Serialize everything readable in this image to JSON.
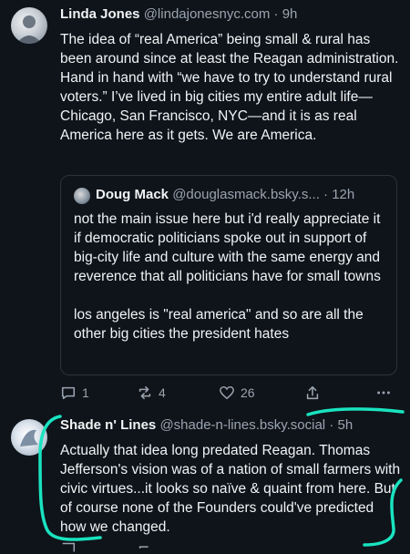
{
  "post1": {
    "name": "Linda Jones",
    "handle": "@lindajonesnyc.com",
    "dot": "·",
    "time": "9h",
    "text": "The idea of “real America” being small & rural has been around since at least the Reagan administration. Hand in hand with “we have to try to understand rural voters.” I’ve lived in big cities my entire adult life—Chicago, San Francisco, NYC—and it is as real America here as it gets. We are America."
  },
  "quote": {
    "name": "Doug Mack",
    "handle": "@douglasmack.bsky.s...",
    "dot": "·",
    "time": "12h",
    "para1": "not the main issue here but i'd really appreciate it if democratic politicians spoke out in support of big-city life and culture with the same energy and reverence that all politicians have for small towns",
    "para2": "los angeles is \"real america\" and so are all the other big cities the president hates"
  },
  "actions": {
    "replies": "1",
    "reposts": "4",
    "likes": "26"
  },
  "post2": {
    "name": "Shade n' Lines",
    "handle": "@shade-n-lines.bsky.social",
    "dot": "·",
    "time": "5h",
    "text": "Actually that idea long predated Reagan. Thomas Jefferson's vision was of a nation of small farmers with civic virtues...it looks so naïve & quaint from here. But of course none of the Founders could've predicted how we changed."
  },
  "colors": {
    "accent_annotation": "#19e3c0",
    "background": "#0f141a",
    "muted": "#9aa4b0"
  }
}
